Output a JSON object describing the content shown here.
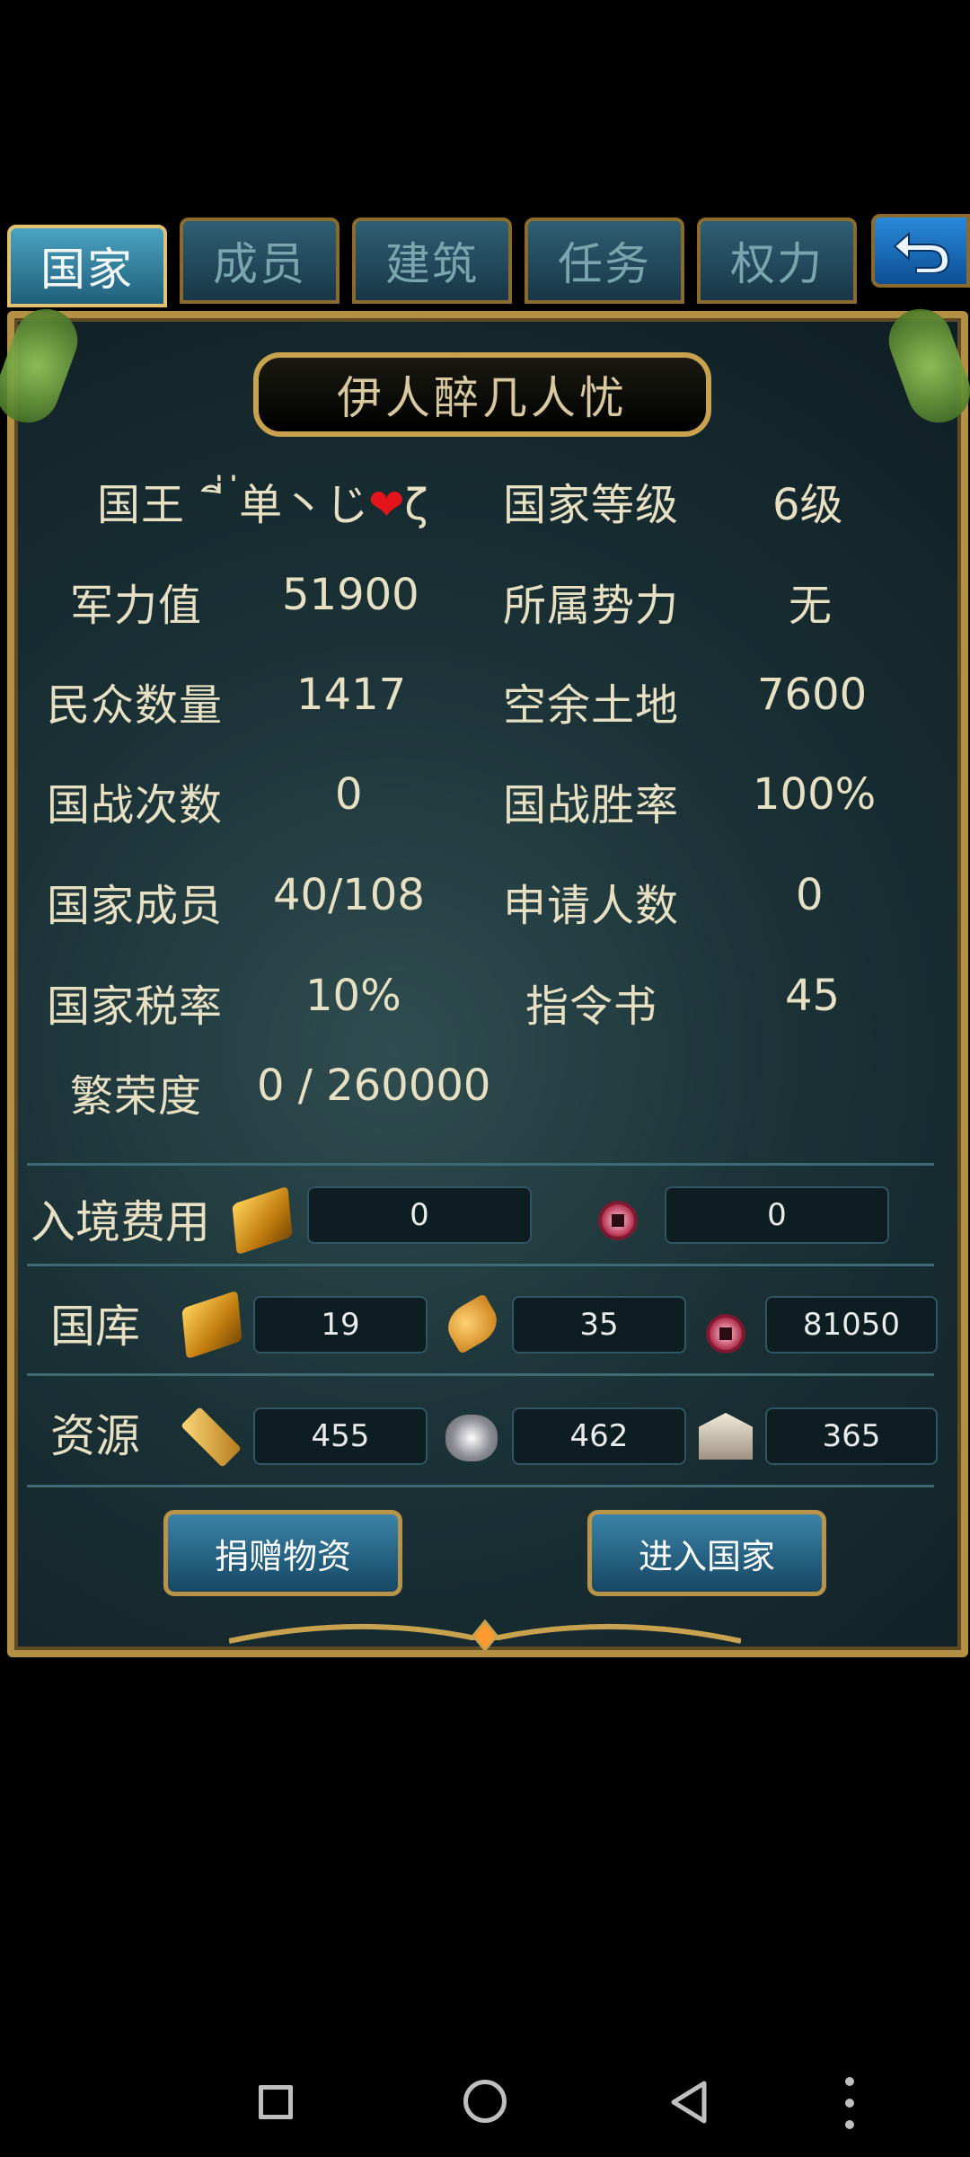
{
  "tabs": [
    {
      "label": "国家",
      "active": true
    },
    {
      "label": "成员",
      "active": false
    },
    {
      "label": "建筑",
      "active": false
    },
    {
      "label": "任务",
      "active": false
    },
    {
      "label": "权力",
      "active": false
    }
  ],
  "back_icon": "return-arrow-icon",
  "country_name": "伊人醉几人忧",
  "stats": {
    "king_label": "国王",
    "king_value_a": "ี่ ่单丶じ",
    "king_value_heart": "❤",
    "king_value_b": "ζ",
    "level_label": "国家等级",
    "level_value": "6级",
    "military_label": "军力值",
    "military_value": "51900",
    "faction_label": "所属势力",
    "faction_value": "无",
    "population_label": "民众数量",
    "population_value": "1417",
    "free_land_label": "空余土地",
    "free_land_value": "7600",
    "war_count_label": "国战次数",
    "war_count_value": "0",
    "war_winrate_label": "国战胜率",
    "war_winrate_value": "100%",
    "members_label": "国家成员",
    "members_value": "40/108",
    "applicants_label": "申请人数",
    "applicants_value": "0",
    "tax_label": "国家税率",
    "tax_value": "10%",
    "orders_label": "指令书",
    "orders_value": "45",
    "prosperity_label": "繁荣度",
    "prosperity_value": "0 / 260000"
  },
  "entry_fee": {
    "label": "入境费用",
    "gold": "0",
    "coin": "0"
  },
  "treasury": {
    "label": "国库",
    "gold": "19",
    "leaf": "35",
    "coin": "81050"
  },
  "resources": {
    "label": "资源",
    "wood": "455",
    "stone": "462",
    "iron": "365"
  },
  "buttons": {
    "donate": "捐赠物资",
    "enter": "进入国家"
  },
  "colors": {
    "panel_border": "#b39043",
    "tab_active": "#4aa3c2",
    "heart": "#e3151b"
  }
}
